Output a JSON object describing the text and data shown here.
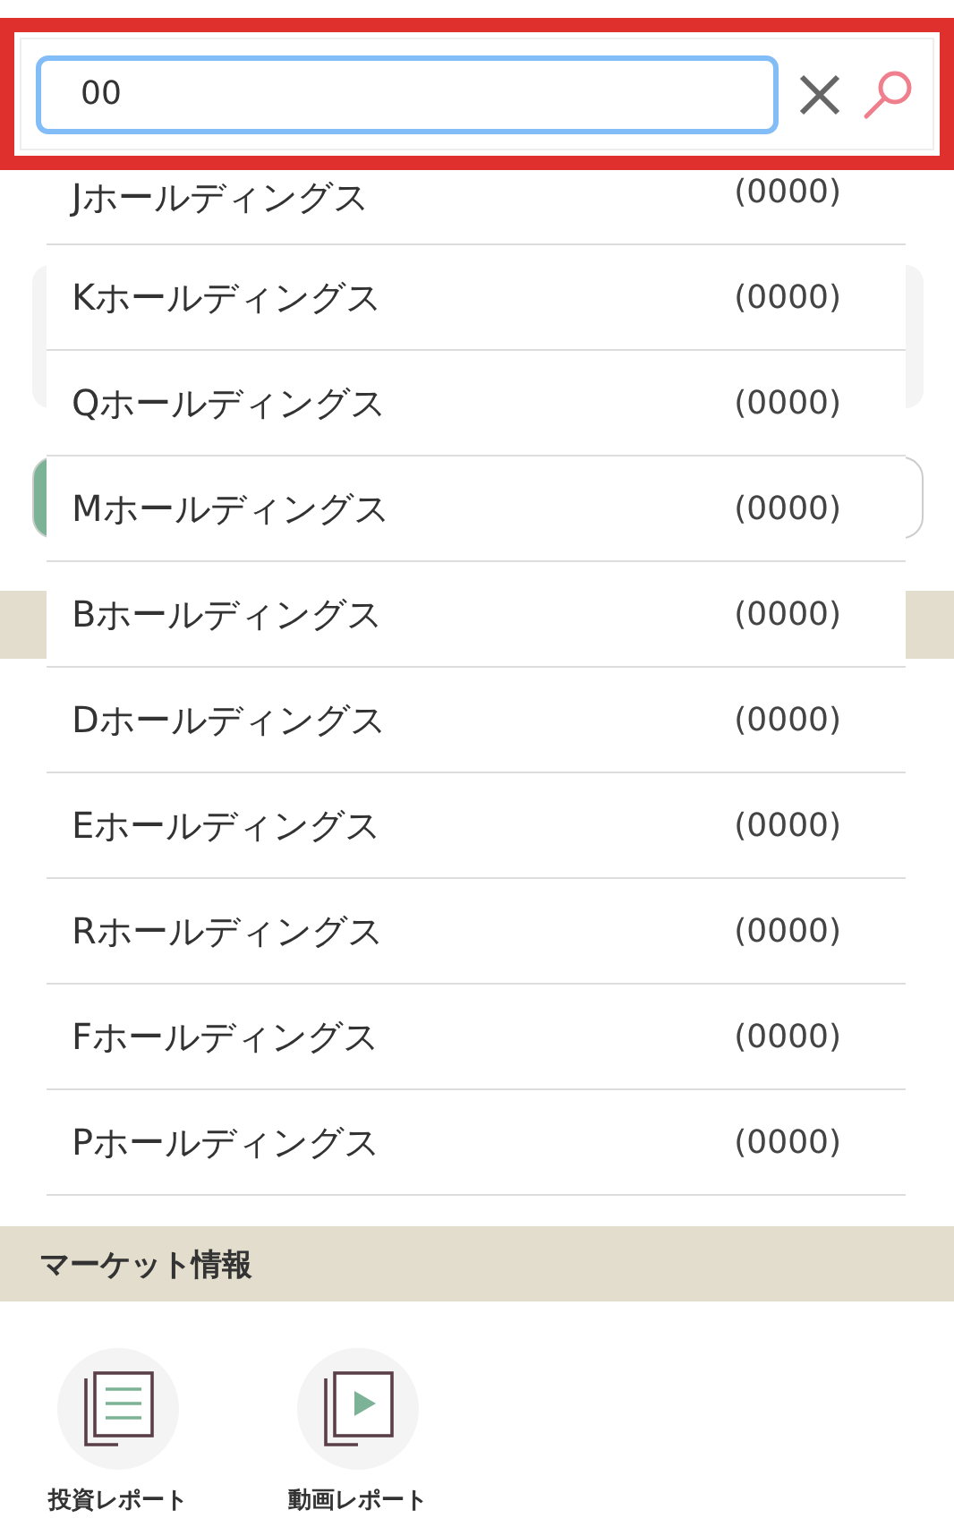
{
  "search": {
    "value": "00"
  },
  "suggestions": [
    {
      "name": "Jホールディングス",
      "code": "(0000)"
    },
    {
      "name": "Kホールディングス",
      "code": "(0000)"
    },
    {
      "name": "Qホールディングス",
      "code": "(0000)"
    },
    {
      "name": "Mホールディングス",
      "code": "(0000)"
    },
    {
      "name": "Bホールディングス",
      "code": "(0000)"
    },
    {
      "name": "Dホールディングス",
      "code": "(0000)"
    },
    {
      "name": "Eホールディングス",
      "code": "(0000)"
    },
    {
      "name": "Rホールディングス",
      "code": "(0000)"
    },
    {
      "name": "Fホールディングス",
      "code": "(0000)"
    },
    {
      "name": "Pホールディングス",
      "code": "(0000)"
    }
  ],
  "market": {
    "title": "マーケット情報",
    "items": [
      {
        "label": "投資レポート",
        "kind": "report"
      },
      {
        "label": "動画レポート",
        "kind": "video"
      }
    ]
  }
}
